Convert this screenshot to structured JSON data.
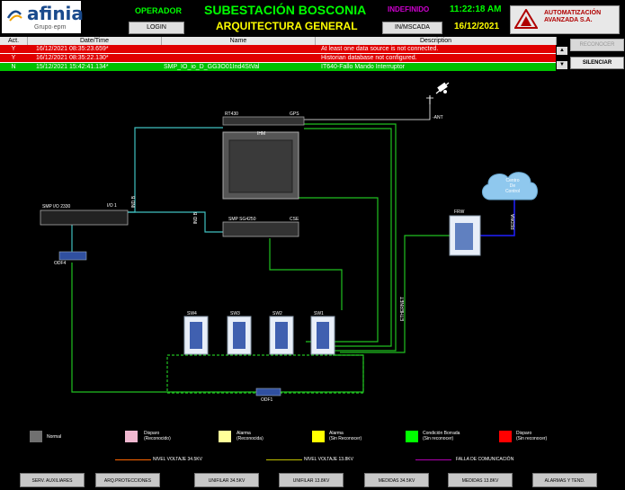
{
  "header": {
    "logo_text": "afinia",
    "logo_sub": "Grupo·epm",
    "operator_label": "OPERADOR",
    "login_label": "LOGIN",
    "station_title": "SUBESTACIÓN BOSCONIA",
    "architecture_title": "ARQUITECTURA GENERAL",
    "state": "INDEFINIDO",
    "time": "11:22:18 AM",
    "date": "16/12/2021",
    "unmask_label": "IN/MSCADA",
    "brand_line1": "AUTOMATIZACIÓN",
    "brand_line2": "AVANZADA S.A."
  },
  "alarm_table": {
    "columns": [
      "Act.",
      "Date/Time",
      "Name",
      "Description"
    ],
    "rows": [
      {
        "act": "Y",
        "datetime": "16/12/2021 08:35:23.659*",
        "name": "",
        "description": "At least one data source is not connected.",
        "color": "#e00000"
      },
      {
        "act": "Y",
        "datetime": "16/12/2021 08:35:22.130*",
        "name": "",
        "description": "Historian database not configured.",
        "color": "#e00000"
      },
      {
        "act": "N",
        "datetime": "15/12/2021 15:42:41.134*",
        "name": "SMP_IO_io_D_GG3O01Ind4StVal",
        "description": "IT640-Fallo Mando Interruptor",
        "color": "#00c000"
      }
    ],
    "recognize_label": "RECONOCER",
    "silence_label": "SILENCIAR"
  },
  "diagram": {
    "rt430": "RT430",
    "gps": "GPS",
    "ant": "-ANT",
    "ihm": "IHM",
    "smp_io": "SMP I/O 2330",
    "io1": "I/O 1",
    "ind_b_1": "IND B",
    "ind_b_2": "IND B",
    "odf_left": "ODF4",
    "smp_sg": "SMP SG4250",
    "cse": "CSE",
    "frw": "FRW",
    "cloud_line1": "Centro",
    "cloud_line2": "De",
    "cloud_line3": "Control",
    "redna": "REDNA",
    "ethernet": "ETHERNET",
    "sw4": "SW4",
    "sw3": "SW3",
    "sw2": "SW2",
    "sw1": "SW1",
    "odf1": "ODF1"
  },
  "legend": {
    "items": [
      {
        "label": "Normal",
        "sub": "",
        "color": "#707070"
      },
      {
        "label": "Disparo",
        "sub": "(Reconocido)",
        "color": "#f0b8d0"
      },
      {
        "label": "Alarma",
        "sub": "(Reconocida)",
        "color": "#ffff99"
      },
      {
        "label": "Alarma",
        "sub": "(Sin Reconocer)",
        "color": "#ffff00"
      },
      {
        "label": "Condición Borrada",
        "sub": "(Sin reconocer)",
        "color": "#00ff00"
      },
      {
        "label": "Disparo",
        "sub": "(Sin reconocer)",
        "color": "#ff0000"
      }
    ],
    "lines": [
      {
        "label": "NIVEL VOLTAJE 34.5KV",
        "color": "#ff6600"
      },
      {
        "label": "NIVEL VOLTAJE 13.8KV",
        "color": "#c0c000"
      },
      {
        "label": "FALLA DE COMUNICACIÓN",
        "color": "#b000b0"
      }
    ]
  },
  "nav": {
    "buttons": [
      "SERV. AUXILIARES",
      "ARQ.PROTECCIONES",
      "UNIFILAR 34.5KV",
      "UNIFILAR 13.8KV",
      "MEDIDAS 34.5KV",
      "MEDIDAS 13.8KV",
      "ALARMAS Y TEND."
    ]
  }
}
